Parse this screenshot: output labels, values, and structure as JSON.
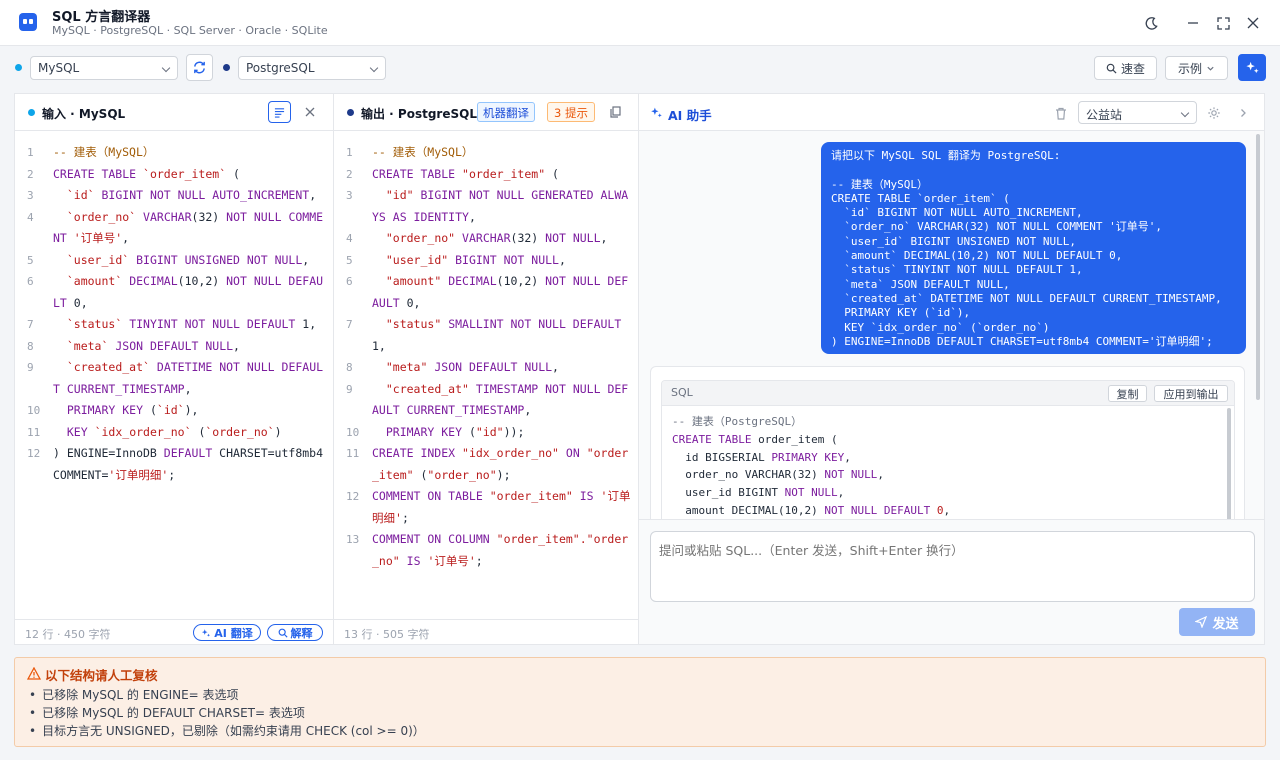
{
  "app": {
    "title": "SQL 方言翻译器",
    "subtitle": "MySQL · PostgreSQL · SQL Server · Oracle · SQLite"
  },
  "toolbar": {
    "source_dialect": "MySQL",
    "target_dialect": "PostgreSQL",
    "quick_ref_label": "速查",
    "examples_label": "示例",
    "source_dot_color": "#0ea5e9",
    "target_dot_color": "#1e3a8a",
    "accent": "#2563eb"
  },
  "input_panel": {
    "title": "输入 · MySQL",
    "footer_stats": "12 行 · 450 字符",
    "ai_translate_label": "AI 翻译",
    "explain_label": "解释",
    "lines": [
      {
        "n": "1",
        "html": "<span class=\"cm\">-- 建表（MySQL）</span>"
      },
      {
        "n": "2",
        "html": "<span class=\"kw\">CREATE TABLE</span> <span class=\"str\">`order_item`</span> ("
      },
      {
        "n": "3",
        "html": "  <span class=\"str\">`id`</span> <span class=\"kw\">BIGINT NOT NULL AUTO_INCREMENT</span>,"
      },
      {
        "n": "4",
        "html": "  <span class=\"str\">`order_no`</span> <span class=\"kw\">VARCHAR</span>(32) <span class=\"kw\">NOT NULL COMMENT</span> <span class=\"str\">'订单号'</span>,"
      },
      {
        "n": "5",
        "html": "  <span class=\"str\">`user_id`</span> <span class=\"kw\">BIGINT UNSIGNED NOT NULL</span>,"
      },
      {
        "n": "6",
        "html": "  <span class=\"str\">`amount`</span> <span class=\"kw\">DECIMAL</span>(10,2) <span class=\"kw\">NOT NULL DEFAULT</span> 0,"
      },
      {
        "n": "7",
        "html": "  <span class=\"str\">`status`</span> <span class=\"kw\">TINYINT NOT NULL DEFAULT</span> 1,"
      },
      {
        "n": "8",
        "html": "  <span class=\"str\">`meta`</span> <span class=\"kw\">JSON DEFAULT NULL</span>,"
      },
      {
        "n": "9",
        "html": "  <span class=\"str\">`created_at`</span> <span class=\"kw\">DATETIME NOT NULL DEFAULT CURRENT_TIMESTAMP</span>,"
      },
      {
        "n": "10",
        "html": "  <span class=\"kw\">PRIMARY KEY</span> (<span class=\"str\">`id`</span>),"
      },
      {
        "n": "11",
        "html": "  <span class=\"kw\">KEY</span> <span class=\"str\">`idx_order_no`</span> (<span class=\"str\">`order_no`</span>)"
      },
      {
        "n": "12",
        "html": ") ENGINE=InnoDB <span class=\"kw\">DEFAULT</span> CHARSET=utf8mb4 COMMENT=<span class=\"str\">'订单明细'</span>;"
      }
    ]
  },
  "output_panel": {
    "title": "输出 · PostgreSQL",
    "machine_badge": "机器翻译",
    "hints_badge": "3 提示",
    "footer_stats": "13 行 · 505 字符",
    "lines": [
      {
        "n": "1",
        "html": "<span class=\"cm\">-- 建表（MySQL）</span>"
      },
      {
        "n": "2",
        "html": "<span class=\"kw\">CREATE TABLE</span> <span class=\"str\">\"order_item\"</span> ("
      },
      {
        "n": "3",
        "html": "  <span class=\"str\">\"id\"</span> <span class=\"kw\">BIGINT NOT NULL GENERATED ALWAYS AS IDENTITY</span>,"
      },
      {
        "n": "4",
        "html": "  <span class=\"str\">\"order_no\"</span> <span class=\"kw\">VARCHAR</span>(32) <span class=\"kw\">NOT NULL</span>,"
      },
      {
        "n": "5",
        "html": "  <span class=\"str\">\"user_id\"</span> <span class=\"kw\">BIGINT NOT NULL</span>,"
      },
      {
        "n": "6",
        "html": "  <span class=\"str\">\"amount\"</span> <span class=\"kw\">DECIMAL</span>(10,2) <span class=\"kw\">NOT NULL DEFAULT</span> 0,"
      },
      {
        "n": "7",
        "html": "  <span class=\"str\">\"status\"</span> <span class=\"kw\">SMALLINT NOT NULL DEFAULT</span> 1,"
      },
      {
        "n": "8",
        "html": "  <span class=\"str\">\"meta\"</span> <span class=\"kw\">JSON DEFAULT NULL</span>,"
      },
      {
        "n": "9",
        "html": "  <span class=\"str\">\"created_at\"</span> <span class=\"kw\">TIMESTAMP NOT NULL DEFAULT CURRENT_TIMESTAMP</span>,"
      },
      {
        "n": "10",
        "html": "  <span class=\"kw\">PRIMARY KEY</span> (<span class=\"str\">\"id\"</span>));"
      },
      {
        "n": "11",
        "html": "<span class=\"kw\">CREATE INDEX</span> <span class=\"str\">\"idx_order_no\"</span> <span class=\"kw\">ON</span> <span class=\"str\">\"order_item\"</span> (<span class=\"str\">\"order_no\"</span>);"
      },
      {
        "n": "12",
        "html": "<span class=\"kw\">COMMENT ON TABLE</span> <span class=\"str\">\"order_item\"</span> <span class=\"kw\">IS</span> <span class=\"str\">'订单明细'</span>;"
      },
      {
        "n": "13",
        "html": "<span class=\"kw\">COMMENT ON COLUMN</span> <span class=\"str\">\"order_item\".\"order_no\"</span> <span class=\"kw\">IS</span> <span class=\"str\">'订单号'</span>;"
      }
    ]
  },
  "ai_panel": {
    "title": "AI 助手",
    "provider": "公益站",
    "user_message": "请把以下 MySQL SQL 翻译为 PostgreSQL:\n\n-- 建表（MySQL）\nCREATE TABLE `order_item` (\n  `id` BIGINT NOT NULL AUTO_INCREMENT,\n  `order_no` VARCHAR(32) NOT NULL COMMENT '订单号',\n  `user_id` BIGINT UNSIGNED NOT NULL,\n  `amount` DECIMAL(10,2) NOT NULL DEFAULT 0,\n  `status` TINYINT NOT NULL DEFAULT 1,\n  `meta` JSON DEFAULT NULL,\n  `created_at` DATETIME NOT NULL DEFAULT CURRENT_TIMESTAMP,\n  PRIMARY KEY (`id`),\n  KEY `idx_order_no` (`order_no`)\n) ENGINE=InnoDB DEFAULT CHARSET=utf8mb4 COMMENT='订单明细';",
    "code_lang": "SQL",
    "copy_label": "复制",
    "apply_label": "应用到输出",
    "reply_lines_html": [
      "<span style=\"color:#6b7280\">-- 建表（PostgreSQL）</span>",
      "<span class=\"kw\">CREATE TABLE</span> order_item (",
      "  id BIGSERIAL <span class=\"kw\">PRIMARY KEY</span>,",
      "  order_no VARCHAR(32) <span class=\"kw\">NOT NULL</span>,",
      "  user_id BIGINT <span class=\"kw\">NOT NULL</span>,",
      "  amount DECIMAL(10,2) <span class=\"kw\">NOT NULL DEFAULT</span> <span class=\"str\">0</span>,"
    ],
    "input_placeholder": "提问或粘贴 SQL...（Enter 发送，Shift+Enter 换行）",
    "send_label": "发送"
  },
  "review": {
    "title": "以下结构请人工复核",
    "items": [
      "已移除 MySQL 的 ENGINE= 表选项",
      "已移除 MySQL 的 DEFAULT CHARSET= 表选项",
      "目标方言无 UNSIGNED，已剔除（如需约束请用 CHECK (col >= 0)）"
    ]
  }
}
